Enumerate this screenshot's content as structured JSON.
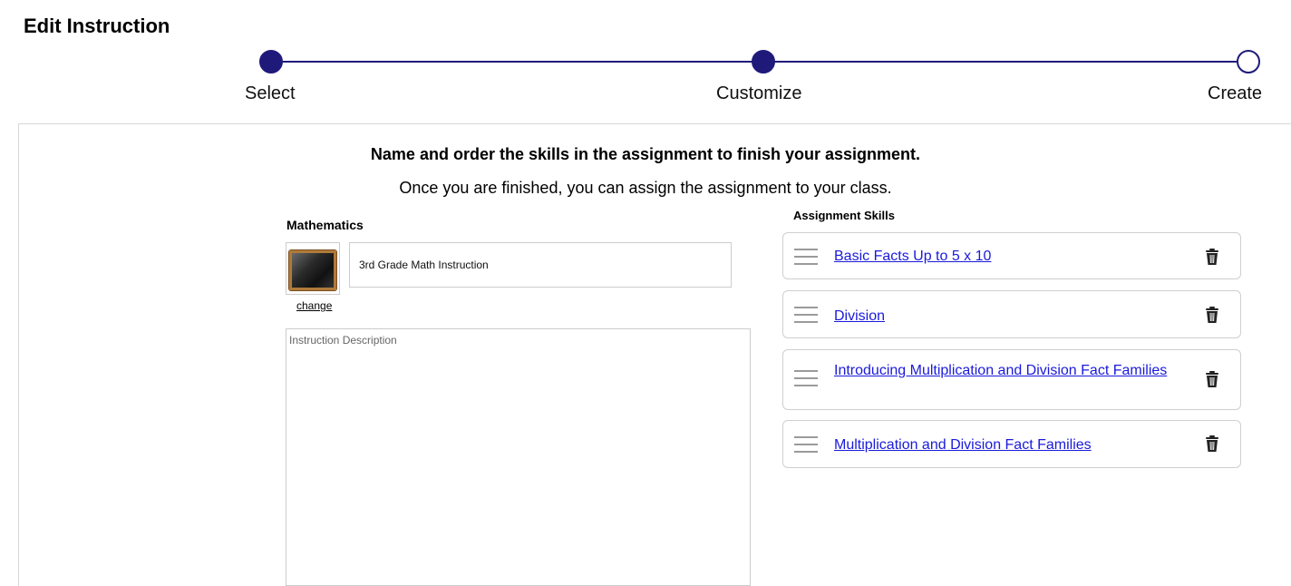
{
  "page_title": "Edit Instruction",
  "stepper": {
    "steps": [
      {
        "label": "Select",
        "state": "complete"
      },
      {
        "label": "Customize",
        "state": "complete"
      },
      {
        "label": "Create",
        "state": "pending"
      }
    ],
    "accent_color": "#1f1a7a"
  },
  "main": {
    "heading": "Name and order the skills in the assignment to finish your assignment.",
    "subheading": "Once you are finished, you can assign the assignment to your class."
  },
  "instruction": {
    "subject": "Mathematics",
    "thumbnail_icon": "chalkboard-icon",
    "change_link": "change",
    "name_value": "3rd Grade Math Instruction",
    "description_placeholder": "Instruction Description",
    "description_value": ""
  },
  "assignment_skills": {
    "label": "Assignment Skills",
    "items": [
      {
        "title": "Basic Facts Up to 5 x 10"
      },
      {
        "title": "Division"
      },
      {
        "title": "Introducing Multiplication and Division Fact Families"
      },
      {
        "title": "Multiplication and Division Fact Families"
      }
    ],
    "link_color": "#1a1adb"
  }
}
